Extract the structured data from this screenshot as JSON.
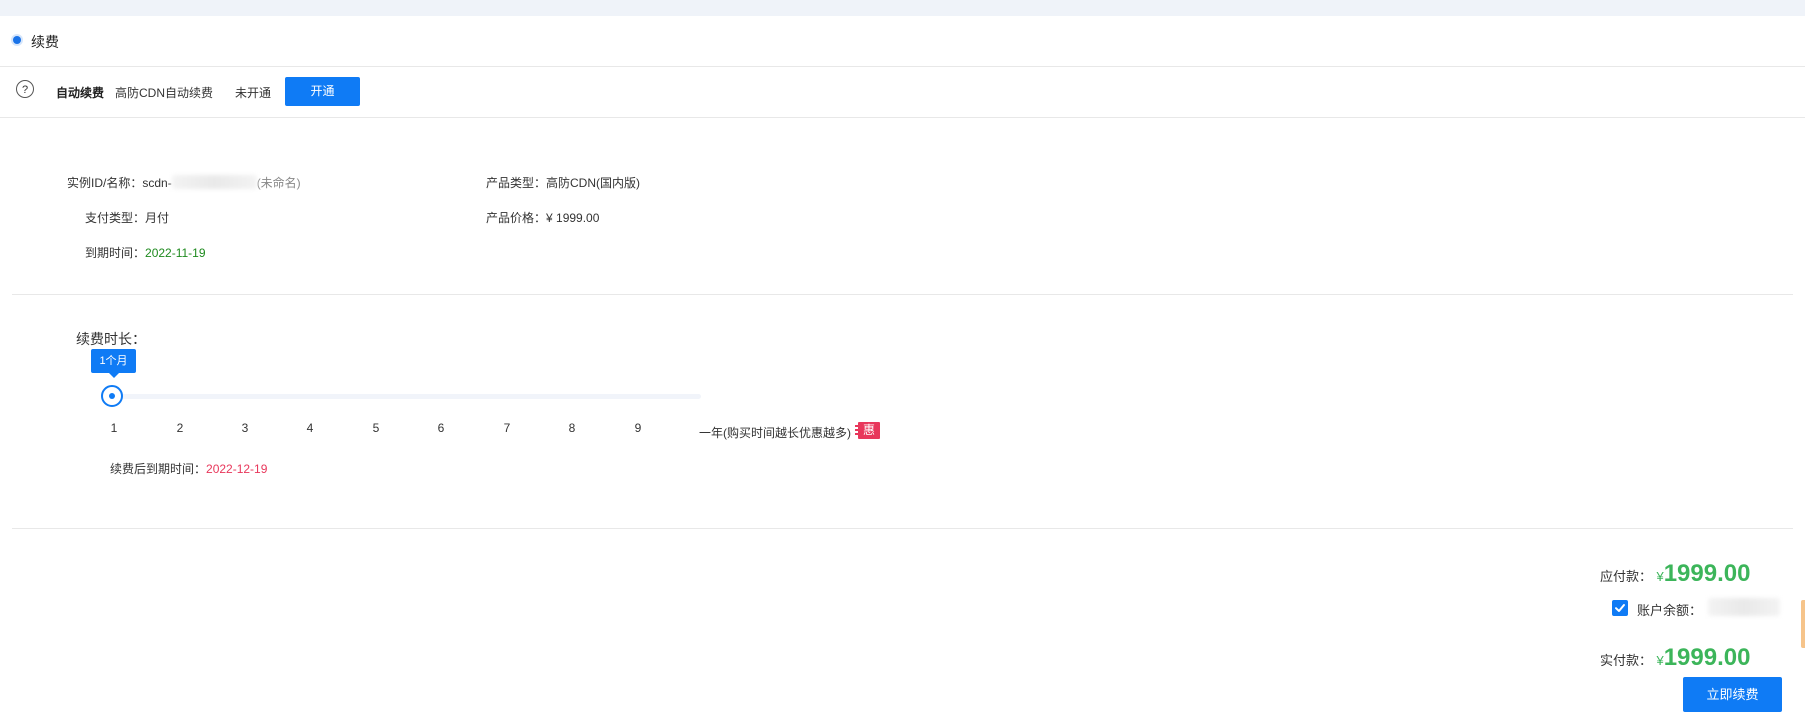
{
  "section": {
    "title": "续费"
  },
  "auto_renew": {
    "help_glyph": "?",
    "label": "自动续费",
    "name": "高防CDN自动续费",
    "status": "未开通",
    "open_button": "开通"
  },
  "instance": {
    "id_label": "实例ID/名称：",
    "id_prefix": "scdn-",
    "id_visible_suffix": "(未命名)",
    "pay_type_label": "支付类型：",
    "pay_type": "月付",
    "expire_label": "到期时间：",
    "expire": "2022-11-19",
    "product_type_label": "产品类型：",
    "product_type": "高防CDN(国内版)",
    "price_label": "产品价格：",
    "price": "¥ 1999.00"
  },
  "duration": {
    "label": "续费时长：",
    "selected": "1个月",
    "ticks": [
      "1",
      "2",
      "3",
      "4",
      "5",
      "6",
      "7",
      "8",
      "9"
    ],
    "year_option": "一年(购买时间越长优惠越多)",
    "discount_badge": "惠",
    "new_expire_label": "续费后到期时间：",
    "new_expire": "2022-12-19"
  },
  "payment": {
    "due_label": "应付款：",
    "due_currency": "¥",
    "due_amount": "1999.00",
    "balance_label": "账户余额：",
    "balance_checked": true,
    "actual_label": "实付款：",
    "actual_currency": "¥",
    "actual_amount": "1999.00",
    "renew_button": "立即续费"
  },
  "colors": {
    "primary": "#0f7bf5",
    "amount_green": "#3cb55a",
    "date_green": "#1e8a1e",
    "date_red": "#e8375b"
  }
}
